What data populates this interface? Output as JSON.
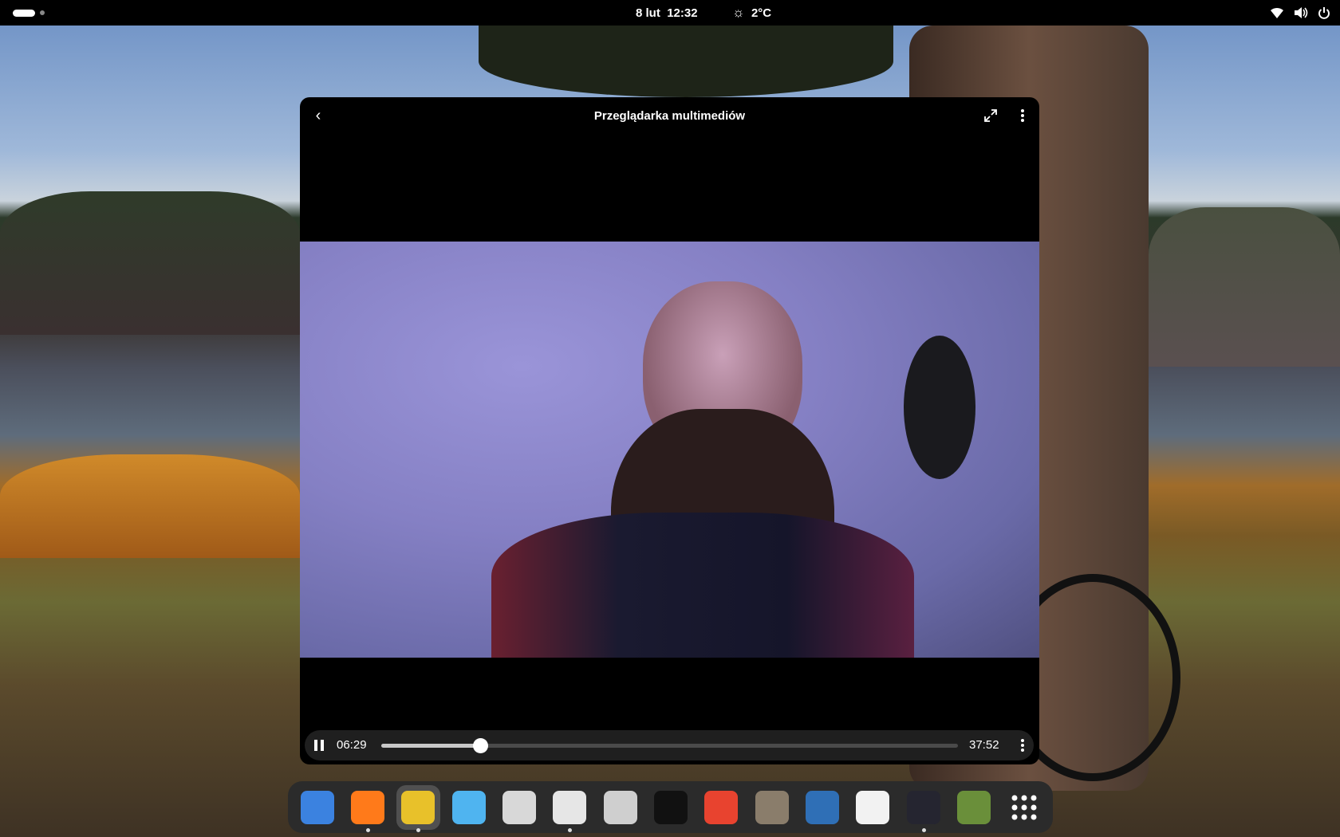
{
  "topbar": {
    "date": "8 lut",
    "time": "12:32",
    "weather_icon": "sun-icon",
    "temperature": "2°C",
    "status_icons": [
      "wifi-icon",
      "volume-icon",
      "power-icon"
    ]
  },
  "window": {
    "title": "Przeglądarka multimediów",
    "back_icon": "chevron-left-icon",
    "fullscreen_icon": "fullscreen-icon",
    "menu_icon": "kebab-menu-icon"
  },
  "player": {
    "state": "playing",
    "elapsed": "06:29",
    "duration": "37:52",
    "progress": 0.171
  },
  "dock": {
    "apps": [
      {
        "icon": "files-icon",
        "color": "#3b82e0",
        "running": false
      },
      {
        "icon": "firefox-icon",
        "color": "#ff7a1a",
        "running": true
      },
      {
        "icon": "tuba-icon",
        "color": "#e8c12a",
        "running": true,
        "active": true
      },
      {
        "icon": "chat-spiral-icon",
        "color": "#4fb4f0",
        "running": false
      },
      {
        "icon": "newspaper-icon",
        "color": "#d8d8d8",
        "running": false
      },
      {
        "icon": "mail-clock-icon",
        "color": "#e6e6e6",
        "running": true
      },
      {
        "icon": "libreoffice-icon",
        "color": "#cfcfcf",
        "running": false
      },
      {
        "icon": "inkscape-icon",
        "color": "#111111",
        "running": false
      },
      {
        "icon": "mountain-app-icon",
        "color": "#e8432f",
        "running": false
      },
      {
        "icon": "gimp-icon",
        "color": "#8a7d6b",
        "running": false
      },
      {
        "icon": "scribus-icon",
        "color": "#2f6fb6",
        "running": false
      },
      {
        "icon": "text-editor-cat-icon",
        "color": "#f2f2f2",
        "running": false
      },
      {
        "icon": "terminal-icon",
        "color": "#252530",
        "running": true
      },
      {
        "icon": "minecraft-icon",
        "color": "#6a8f3a",
        "running": false
      }
    ],
    "grid_icon": "app-grid-icon"
  }
}
